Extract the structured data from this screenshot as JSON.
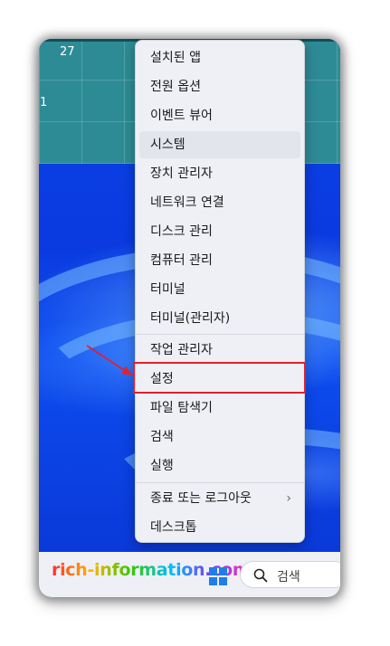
{
  "calendar": {
    "day_label": "27",
    "side_number": "1"
  },
  "menu": {
    "items": [
      {
        "label": "설치된 앱"
      },
      {
        "label": "전원 옵션"
      },
      {
        "label": "이벤트 뷰어"
      },
      {
        "label": "시스템"
      },
      {
        "label": "장치 관리자"
      },
      {
        "label": "네트워크 연결"
      },
      {
        "label": "디스크 관리"
      },
      {
        "label": "컴퓨터 관리"
      },
      {
        "label": "터미널"
      },
      {
        "label": "터미널(관리자)"
      },
      {
        "label": "작업 관리자"
      },
      {
        "label": "설정"
      },
      {
        "label": "파일 탐색기"
      },
      {
        "label": "검색"
      },
      {
        "label": "실행"
      },
      {
        "label": "종료 또는 로그아웃"
      },
      {
        "label": "데스크톱"
      }
    ],
    "submenu_glyph": "›"
  },
  "taskbar": {
    "watermark": "rich-information.com",
    "search_placeholder": "검색"
  },
  "colors": {
    "highlight": "#e3202a",
    "wallpaper": "#0a3fd9",
    "windows_logo": "#1f7ee8"
  }
}
